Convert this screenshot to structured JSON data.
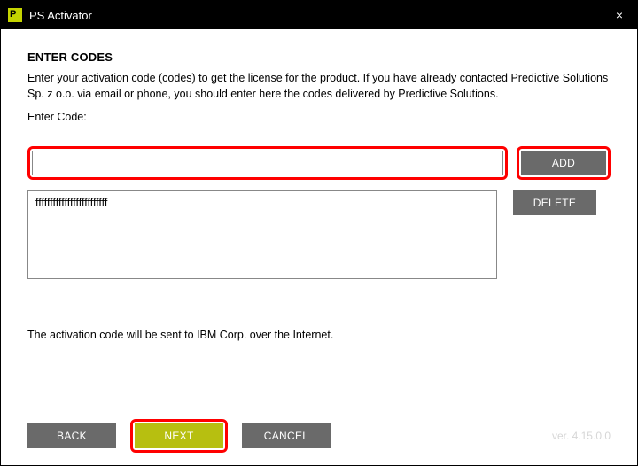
{
  "window": {
    "title": "PS Activator",
    "closeGlyph": "×"
  },
  "heading": "ENTER CODES",
  "description": "Enter your activation code (codes) to get the license for the product. If you have already contacted Predictive Solutions Sp. z o.o. via email or phone, you should enter here the codes delivered by Predictive Solutions.",
  "enterCodeLabel": "Enter Code:",
  "codeInput": {
    "value": "",
    "placeholder": ""
  },
  "buttons": {
    "add": "ADD",
    "delete": "DELETE",
    "back": "BACK",
    "next": "NEXT",
    "cancel": "CANCEL"
  },
  "codes": [
    "fffffffffffffffffffffffff"
  ],
  "note": "The activation code will be sent to IBM Corp. over the Internet.",
  "version": "ver. 4.15.0.0"
}
